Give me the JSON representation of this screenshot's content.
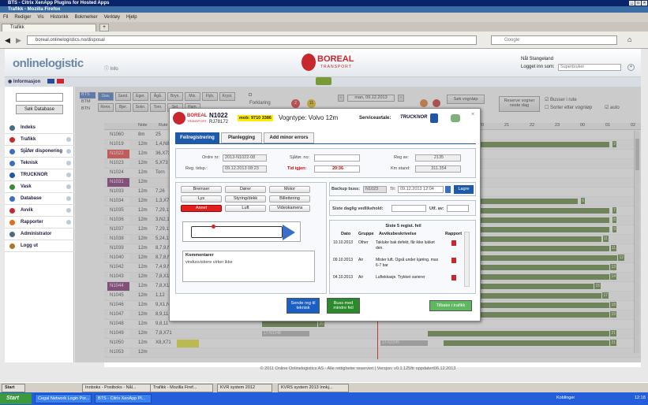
{
  "window": {
    "title": "BTS - Citrix XenApp Plugins for Hosted Apps",
    "subtitle": "Trafikk - Mozilla Firefox"
  },
  "menu": [
    "Fil",
    "Rediger",
    "Vis",
    "Historikk",
    "Bokmerker",
    "Verktøy",
    "Hjelp"
  ],
  "browser": {
    "tab": "Trafikk",
    "url": "boreal.onlinelogistics.no/disposal",
    "search_placeholder": "Google"
  },
  "app": {
    "logo": "onlinelogistic",
    "info": "Info",
    "brand": "BOREAL",
    "brand_sub": "TRANSPORT",
    "user": "Nål Stangeland",
    "logged_in_label": "Logget inn som:",
    "role": "Superbruker",
    "info_menu": "Informasjon"
  },
  "sidebar": {
    "search_button": "Søk Database",
    "items": [
      "Indeks",
      "Trafikk",
      "Sjåfør disponering",
      "Teknisk",
      "TRUCKNOR",
      "Vask",
      "Database",
      "Avvik",
      "Rapporter",
      "Administrator",
      "Logg ut"
    ]
  },
  "toolbar": {
    "depots_left": [
      "BTS",
      "BTM",
      "BTN"
    ],
    "depots": [
      "Stav.",
      "Sand.",
      "Eger.",
      "Ågå.",
      "Bryn.",
      "Mix.",
      "Flyb.",
      "Kryst.",
      "Renn.",
      "Bjer.",
      "Sokn.",
      "Torn.",
      "Sel.",
      "Ham."
    ],
    "forklaring": "Forklaring",
    "badge1": "2",
    "badge2": "11",
    "date": "man, 09.12.2013",
    "search_btn": "Søk vognløp",
    "reserve_btn": "Reserve vogner neste dag",
    "cb1": "Busser i rute",
    "cb2": "Sorter etter vognløp",
    "auto": "auto"
  },
  "grid": {
    "headers": [
      "Note",
      "Rute"
    ],
    "hours": [
      "16",
      "17",
      "18",
      "19",
      "20",
      "21",
      "22",
      "23",
      "00",
      "01",
      "02"
    ],
    "rows": [
      {
        "id": "N1060",
        "note": "8m",
        "route": "25",
        "color": "#ffffff"
      },
      {
        "id": "N1019",
        "note": "12m",
        "route": "1,4,N8",
        "color": "#ffffff"
      },
      {
        "id": "N1022",
        "note": "12m",
        "route": "36,X73",
        "color": "#e33"
      },
      {
        "id": "N1023",
        "note": "12m",
        "route": "5,X73",
        "color": "#ffffff"
      },
      {
        "id": "N1024",
        "note": "12m",
        "route": "Torn",
        "color": "#ffffff"
      },
      {
        "id": "N1031",
        "note": "12m",
        "route": "",
        "color": "#7a1f6e"
      },
      {
        "id": "N1033",
        "note": "12m",
        "route": "7,26",
        "color": "#ffffff"
      },
      {
        "id": "N1034",
        "note": "12m",
        "route": "1,3,X7",
        "color": "#ffffff"
      },
      {
        "id": "N1035",
        "note": "12m",
        "route": "7,29,11",
        "color": "#ffffff"
      },
      {
        "id": "N1036",
        "note": "12m",
        "route": "3,N2,11",
        "color": "#ffffff"
      },
      {
        "id": "N1037",
        "note": "12m",
        "route": "7,29,11",
        "color": "#ffffff"
      },
      {
        "id": "N1038",
        "note": "12m",
        "route": "5,24,11",
        "color": "#ffffff"
      },
      {
        "id": "N1039",
        "note": "12m",
        "route": "8,7,9,N",
        "color": "#ffffff"
      },
      {
        "id": "N1040",
        "note": "12m",
        "route": "8,7,8,N",
        "color": "#ffffff"
      },
      {
        "id": "N1042",
        "note": "12m",
        "route": "7,4,9,N",
        "color": "#ffffff"
      },
      {
        "id": "N1043",
        "note": "12m",
        "route": "7,8,X1",
        "color": "#ffffff"
      },
      {
        "id": "N1044",
        "note": "12m",
        "route": "7,8,X1",
        "color": "#7a1f6e"
      },
      {
        "id": "N1045",
        "note": "12m",
        "route": "1,12",
        "color": "#ffffff"
      },
      {
        "id": "N1046",
        "note": "12m",
        "route": "9,X1,N",
        "color": "#ffffff"
      },
      {
        "id": "N1047",
        "note": "12m",
        "route": "8,9,11,",
        "color": "#ffffff"
      },
      {
        "id": "N1048",
        "note": "12m",
        "route": "9,8,11",
        "color": "#ffffff"
      },
      {
        "id": "N1049",
        "note": "12m",
        "route": "7,8,X71",
        "color": "#ffffff"
      },
      {
        "id": "N1050",
        "note": "12m",
        "route": "X8,X71",
        "color": "#ffffff"
      },
      {
        "id": "N1053",
        "note": "12m",
        "route": "",
        "color": "#ffffff"
      }
    ],
    "bar_labels": [
      "2",
      "6",
      "7",
      "8",
      "9",
      "11",
      "12",
      "13",
      "14",
      "15",
      "17",
      "18",
      "19",
      "20",
      "21"
    ],
    "trip_labels": [
      "N1040",
      "17-N1048",
      "17-N1049"
    ]
  },
  "dialog": {
    "vehicle": "N1022",
    "plate": "RJ78172",
    "mobil": "mob: 9710 3386",
    "vogntype": "Vogntype: Volvo 12m",
    "serviceavtale": "Serviceavtale:",
    "partner": "TRUCKNOR",
    "tabs": [
      "Feilregistrering",
      "Planlegging",
      "Add minor errors"
    ],
    "ordre_label": "Ordre nr:",
    "ordre": "2013-N1022-08",
    "sjafor_label": "Sjåfør. no:",
    "reg_av_label": "Reg av:",
    "reg_av": "2135",
    "reg_tid_label": "Reg. tidsp.:",
    "reg_tid": "09.12.2013 08:23",
    "tid_igjen_label": "Tid igjen:",
    "tid_igjen": "20:36",
    "km_label": "Km stand:",
    "km": "311.354",
    "chips": [
      "Bremser",
      "Dører",
      "Motor",
      "Lys",
      "Styring/dekk",
      "Billettering",
      "Annet",
      "Luft",
      "Videokamera"
    ],
    "kommentar_label": "Kommentarer",
    "kommentar": "vindusviskere virker ikke",
    "backup_label": "Backup buss:",
    "backup": "N1023",
    "til_label": "Til:",
    "til": "09.12.2013 12:04",
    "lagre": "Lagre",
    "siste_label": "Siste daglig vedlikehold:",
    "utf_label": "Utf. av:",
    "regist_title": "Siste 5 regist. feil",
    "regist_headers": [
      "Dato",
      "Gruppe",
      "Avviksbeskrivelse",
      "Rapport"
    ],
    "regist": [
      {
        "dato": "10.10.2013",
        "gruppe": "Other",
        "tekst": "Takluke bak defekt, får ikke lukket den."
      },
      {
        "dato": "09.10.2013",
        "gruppe": "Air",
        "tekst": "Mister luft. Også under kjøring. max 6-7 bar"
      },
      {
        "dato": "04.10.2013",
        "gruppe": "Air",
        "tekst": "Luftekkasje. Trykket varierer"
      }
    ],
    "btn_send": "Sende reg til teknisk",
    "btn_buss": "Buss med mindre feil",
    "btn_back": "Tilbake i trafikk"
  },
  "footer": "© 2011 Online Onlinelogistics AS - Alle rettigheter reservert   |   Versjon: v0.1.125ftr oppdatert06.12.2013",
  "taskbar": {
    "start": "Start",
    "items": [
      "Innboks - Postboks - Nål...",
      "Trafikk - Mozilla Firef...",
      "KVR system 2012",
      "KVRS system 2013 Innkj..."
    ],
    "items2": [
      "Cegal Network Login Por...",
      "BTS - Citrix XenApp Pl..."
    ],
    "tray": "Koblinger",
    "clock": "12:18"
  }
}
